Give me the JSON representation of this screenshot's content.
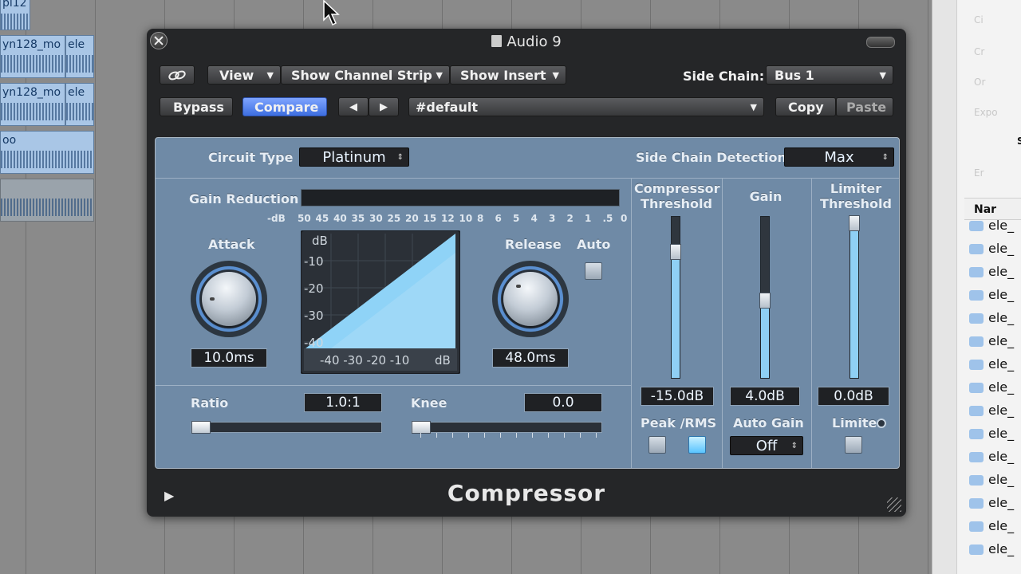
{
  "window": {
    "title": "Audio 9",
    "plugin_name": "Compressor"
  },
  "toolbar": {
    "view_label": "View",
    "show_channel_strip_label": "Show Channel Strip",
    "show_insert_label": "Show Insert",
    "side_chain_label": "Side Chain:",
    "side_chain_value": "Bus 1",
    "bypass_label": "Bypass",
    "compare_label": "Compare",
    "prev_arrow": "◀",
    "next_arrow": "▶",
    "preset_value": "#default",
    "copy_label": "Copy",
    "paste_label": "Paste"
  },
  "compressor": {
    "circuit_type_label": "Circuit Type",
    "circuit_type_value": "Platinum",
    "side_chain_detection_label": "Side Chain Detection",
    "side_chain_detection_value": "Max",
    "gain_reduction_label": "Gain Reduction",
    "gr_scale": [
      "-dB",
      "50",
      "45",
      "40",
      "35",
      "30",
      "25",
      "20",
      "15",
      "12",
      "10",
      "8",
      "6",
      "5",
      "4",
      "3",
      "2",
      "1",
      ".5",
      "0"
    ],
    "attack_label": "Attack",
    "attack_value": "10.0ms",
    "release_label": "Release",
    "release_value": "48.0ms",
    "auto_label": "Auto",
    "graph_db_label": "dB",
    "graph_y_ticks": [
      "-10",
      "-20",
      "-30",
      "-40"
    ],
    "graph_x_ticks": "-40 -30 -20 -10",
    "graph_x_unit": "dB",
    "ratio_label": "Ratio",
    "ratio_value": "1.0:1",
    "knee_label": "Knee",
    "knee_value": "0.0",
    "comp_threshold_label": "Compressor Threshold",
    "comp_threshold_value": "-15.0dB",
    "gain_label": "Gain",
    "gain_value": "4.0dB",
    "limiter_threshold_label": "Limiter Threshold",
    "limiter_threshold_value": "0.0dB",
    "peak_rms_label": "Peak /RMS",
    "auto_gain_label": "Auto Gain",
    "auto_gain_value": "Off",
    "limiter_label": "Limiter",
    "comp_threshold_level": 0.78,
    "gain_level": 0.48,
    "limiter_threshold_level": 1.0
  },
  "arrange": {
    "regions": [
      "yn128_mo",
      "ele",
      "yn128_mo",
      "ele",
      "oo",
      "pi12"
    ]
  },
  "right_panel": {
    "header": "Nar",
    "menu_items": [
      "Ci",
      "Cr",
      "Or",
      "Expo",
      "S",
      "Er"
    ],
    "rows": [
      "ele_",
      "ele_",
      "ele_",
      "ele_",
      "ele_",
      "ele_",
      "ele_",
      "ele_",
      "ele_",
      "ele_",
      "ele_",
      "ele_",
      "ele_",
      "ele_",
      "ele_"
    ]
  },
  "colors": {
    "accent": "#3d6ee0",
    "panel": "#6f8aa6",
    "fader_fill": "#8fd0f5"
  }
}
